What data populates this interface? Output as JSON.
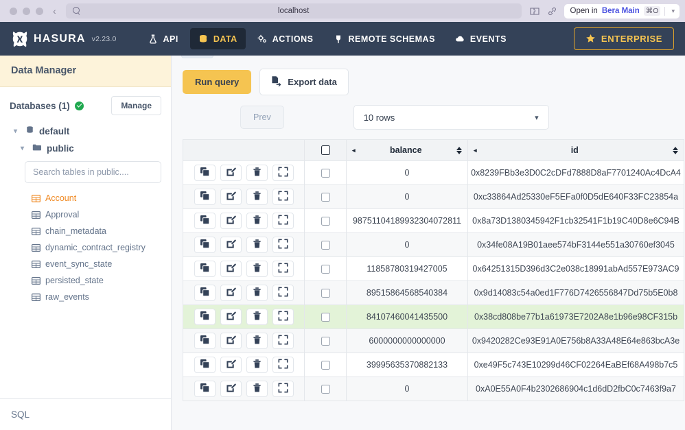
{
  "browser": {
    "url": "localhost",
    "back_label": "‹",
    "open_in_prefix": "Open in",
    "open_in_app": "Bera Main",
    "open_in_shortcut": "⌘O"
  },
  "topnav": {
    "brand": "HASURA",
    "version": "v2.23.0",
    "items": [
      {
        "label": "API",
        "icon": "flask-icon",
        "active": false
      },
      {
        "label": "DATA",
        "icon": "database-icon",
        "active": true
      },
      {
        "label": "ACTIONS",
        "icon": "gears-icon",
        "active": false
      },
      {
        "label": "REMOTE SCHEMAS",
        "icon": "plug-icon",
        "active": false
      },
      {
        "label": "EVENTS",
        "icon": "cloud-icon",
        "active": false
      }
    ],
    "enterprise_label": "ENTERPRISE",
    "enterprise_icon": "star-icon",
    "accent": "#f5c451",
    "bg": "#344258"
  },
  "sidebar": {
    "title": "Data Manager",
    "databases_label": "Databases (1)",
    "status_icon": "check-circle-icon",
    "manage_label": "Manage",
    "tree": [
      {
        "label": "default",
        "icon": "database-icon",
        "level": 1
      },
      {
        "label": "public",
        "icon": "folder-icon",
        "level": 2
      }
    ],
    "search_placeholder": "Search tables in public....",
    "search_value": "",
    "tables": [
      {
        "label": "Account",
        "active": true
      },
      {
        "label": "Approval",
        "active": false
      },
      {
        "label": "chain_metadata",
        "active": false
      },
      {
        "label": "dynamic_contract_registry",
        "active": false
      },
      {
        "label": "event_sync_state",
        "active": false
      },
      {
        "label": "persisted_state",
        "active": false
      },
      {
        "label": "raw_events",
        "active": false
      }
    ],
    "sql_label": "SQL",
    "active_color": "#f08a24"
  },
  "toolbar": {
    "run_query_label": "Run query",
    "export_label": "Export data",
    "export_icon": "file-export-icon",
    "prev_label": "Prev",
    "rows_select_value": "10 rows",
    "rows_chevron_icon": "chevron-down-icon"
  },
  "table": {
    "columns": [
      {
        "key": "actions",
        "label": "",
        "sortable": false
      },
      {
        "key": "check",
        "label": "",
        "sortable": false
      },
      {
        "key": "balance",
        "label": "balance",
        "sortable": true
      },
      {
        "key": "id",
        "label": "id",
        "sortable": true
      }
    ],
    "row_actions": [
      {
        "name": "clone-row-button",
        "icon": "copy-icon"
      },
      {
        "name": "edit-row-button",
        "icon": "edit-pencil-icon"
      },
      {
        "name": "delete-row-button",
        "icon": "trash-icon"
      },
      {
        "name": "expand-row-button",
        "icon": "expand-icon"
      }
    ],
    "rows": [
      {
        "balance": "0",
        "id": "0x8239FBb3e3D0C2cDFd7888D8aF7701240Ac4DcA4",
        "highlighted": false
      },
      {
        "balance": "0",
        "id": "0xc33864Ad25330eF5EFa0f0D5dE640F33FC23854a",
        "highlighted": false
      },
      {
        "balance": "98751104189932304072811",
        "id": "0x8a73D1380345942F1cb32541F1b19C40D8e6C94B",
        "highlighted": false
      },
      {
        "balance": "0",
        "id": "0x34fe08A19B01aee574bF3144e551a30760ef3045",
        "highlighted": false
      },
      {
        "balance": "11858780319427005",
        "id": "0x64251315D396d3C2e038c18991abAd557E973AC9",
        "highlighted": false
      },
      {
        "balance": "89515864568540384",
        "id": "0x9d14083c54a0ed1F776D7426556847Dd75b5E0b8",
        "highlighted": false
      },
      {
        "balance": "84107460041435500",
        "id": "0x38cd808be77b1a61973E7202A8e1b96e98CF315b",
        "highlighted": true
      },
      {
        "balance": "6000000000000000",
        "id": "0x9420282Ce93E91A0E756b8A33A48E64e863bcA3e",
        "highlighted": false
      },
      {
        "balance": "39995635370882133",
        "id": "0xe49F5c743E10299d46CF02264EaBEf68A498b7c5",
        "highlighted": false
      },
      {
        "balance": "0",
        "id": "0xA0E55A0F4b2302686904c1d6dD2fbC0c7463f9a7",
        "highlighted": false
      }
    ],
    "highlight_color": "#e3f3d8"
  }
}
